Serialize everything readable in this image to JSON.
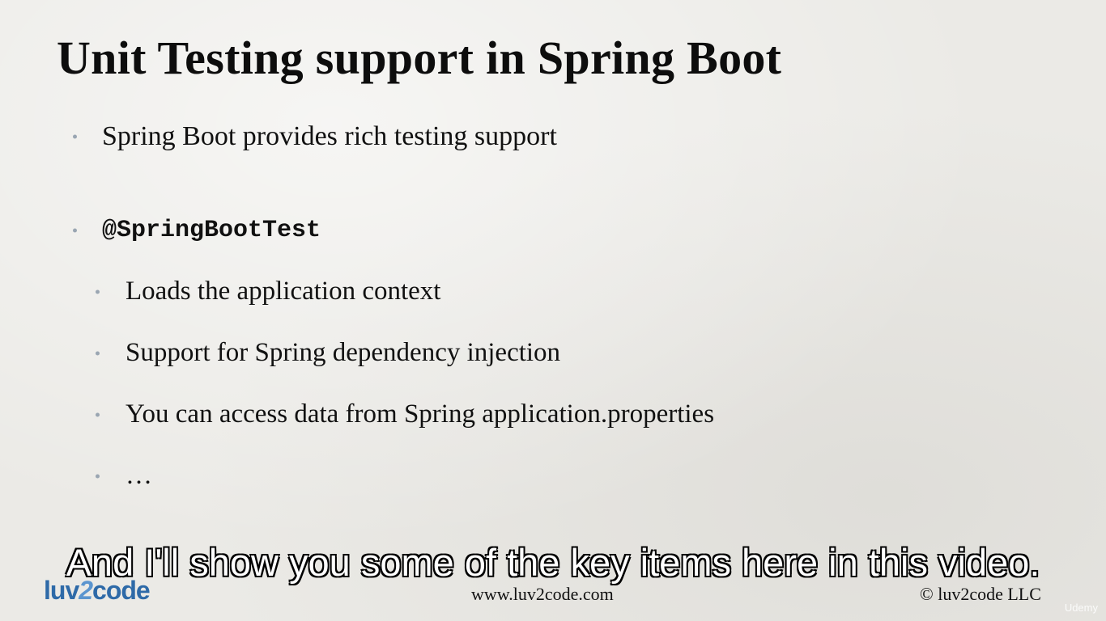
{
  "slide": {
    "title": "Unit Testing support in Spring Boot",
    "bullets": [
      {
        "text": "Spring Boot provides rich testing support"
      },
      {
        "text": "@SpringBootTest"
      }
    ],
    "sub_bullets": [
      {
        "text": "Loads the application context"
      },
      {
        "text": "Support for Spring dependency injection"
      },
      {
        "text": "You can access data from Spring application.properties"
      },
      {
        "text": "…"
      }
    ],
    "footer_url": "www.luv2code.com",
    "footer_copyright": "© luv2code LLC",
    "logo": {
      "part1": "luv",
      "part2": "2",
      "part3": "code"
    }
  },
  "caption": "And I'll show you some of the key items here in this video.",
  "watermark": "Udemy",
  "colors": {
    "background": "#ebeae6",
    "bullet_dot": "#9aa6b2",
    "logo_blue": "#2e6aa8",
    "caption_text": "#ffffff"
  }
}
